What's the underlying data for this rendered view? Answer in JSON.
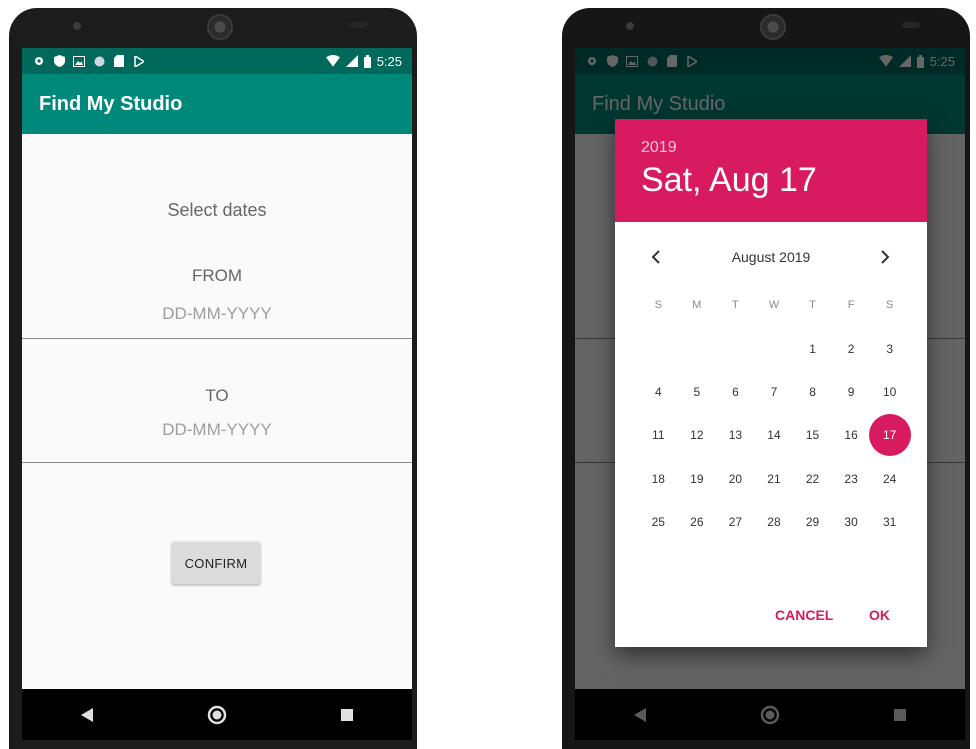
{
  "status_bar": {
    "time": "5:25",
    "icons": [
      "gear-icon",
      "shield-icon",
      "image-icon",
      "circle-icon",
      "sd-card-icon",
      "play-icon"
    ],
    "right_icons": [
      "wifi-icon",
      "signal-icon",
      "battery-icon"
    ]
  },
  "app": {
    "title": "Find My Studio"
  },
  "form": {
    "heading": "Select dates",
    "from_label": "FROM",
    "from_placeholder": "DD-MM-YYYY",
    "to_label": "TO",
    "to_placeholder": "DD-MM-YYYY",
    "confirm_label": "CONFIRM"
  },
  "date_picker": {
    "year": "2019",
    "selected_date_text": "Sat, Aug 17",
    "month_label": "August 2019",
    "weekdays": [
      "S",
      "M",
      "T",
      "W",
      "T",
      "F",
      "S"
    ],
    "weeks": [
      [
        "",
        "",
        "",
        "",
        "1",
        "2",
        "3"
      ],
      [
        "4",
        "5",
        "6",
        "7",
        "8",
        "9",
        "10"
      ],
      [
        "11",
        "12",
        "13",
        "14",
        "15",
        "16",
        "17"
      ],
      [
        "18",
        "19",
        "20",
        "21",
        "22",
        "23",
        "24"
      ],
      [
        "25",
        "26",
        "27",
        "28",
        "29",
        "30",
        "31"
      ]
    ],
    "selected_day": "17",
    "cancel_label": "CANCEL",
    "ok_label": "OK"
  },
  "colors": {
    "primary": "#00897b",
    "primary_dark": "#00695c",
    "accent": "#d81b60"
  }
}
